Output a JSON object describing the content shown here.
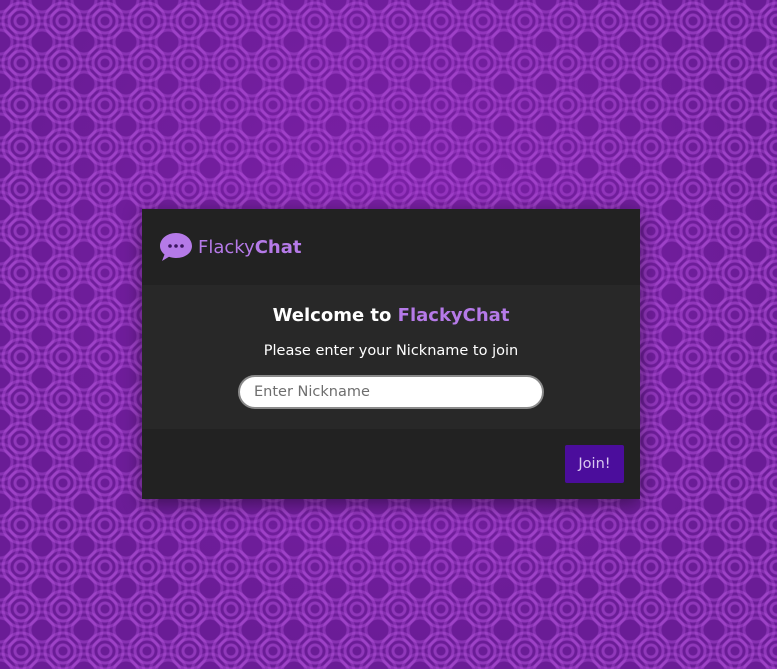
{
  "background": {
    "base_color": "#6a1c96",
    "pattern": "purple-swirl"
  },
  "header": {
    "logo_icon": "chat-bubble-icon",
    "brand_light": "Flacky",
    "brand_bold": "Chat",
    "brand_color": "#b57ae8"
  },
  "body": {
    "welcome_prefix": "Welcome to ",
    "welcome_accent": "FlackyChat",
    "subtitle": "Please enter your Nickname to join",
    "nickname_input": {
      "value": "",
      "placeholder": "Enter Nickname"
    }
  },
  "footer": {
    "join_label": "Join!",
    "join_color": "#4b0d9c"
  }
}
